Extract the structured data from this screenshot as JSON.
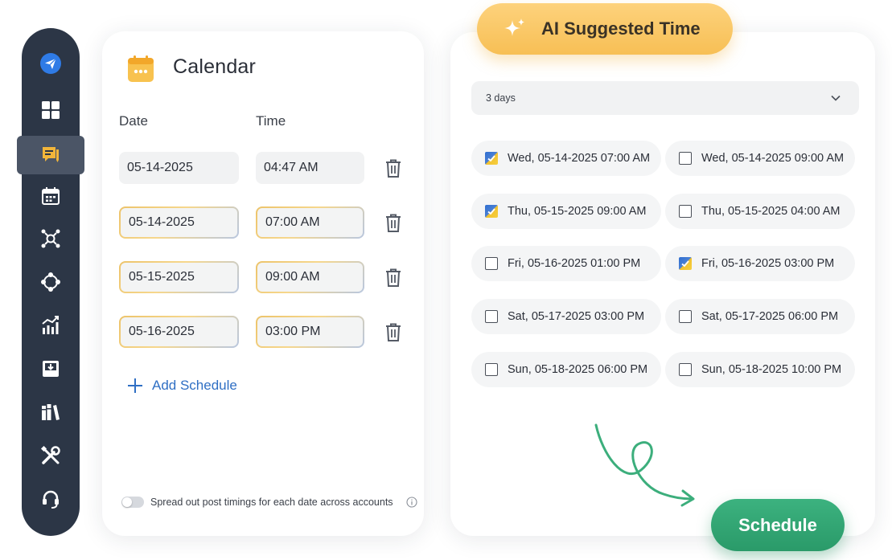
{
  "sidebar": {
    "items": [
      {
        "icon": "send-icon"
      },
      {
        "icon": "dashboard-icon"
      },
      {
        "icon": "compose-icon",
        "active": true
      },
      {
        "icon": "calendar-icon"
      },
      {
        "icon": "network-icon"
      },
      {
        "icon": "hub-icon"
      },
      {
        "icon": "analytics-icon"
      },
      {
        "icon": "inbox-icon"
      },
      {
        "icon": "library-icon"
      },
      {
        "icon": "tools-icon"
      },
      {
        "icon": "support-icon"
      }
    ]
  },
  "calendar": {
    "title": "Calendar",
    "date_label": "Date",
    "time_label": "Time",
    "rows": [
      {
        "date": "05-14-2025",
        "time": "04:47 AM",
        "highlighted": false
      },
      {
        "date": "05-14-2025",
        "time": "07:00 AM",
        "highlighted": true
      },
      {
        "date": "05-15-2025",
        "time": "09:00 AM",
        "highlighted": true
      },
      {
        "date": "05-16-2025",
        "time": "03:00 PM",
        "highlighted": true
      }
    ],
    "add_schedule_label": "Add Schedule",
    "spread_label": "Spread out post timings for each date across accounts"
  },
  "ai": {
    "badge_label": "AI Suggested Time",
    "range_value": "3 days",
    "slots": [
      [
        "Wed, 05-14-2025 07:00 AM",
        "Wed, 05-14-2025 09:00 AM"
      ],
      [
        "Thu, 05-15-2025 09:00 AM",
        "Thu, 05-15-2025 04:00 AM"
      ],
      [
        "Fri, 05-16-2025 01:00 PM",
        "Fri, 05-16-2025 03:00 PM"
      ],
      [
        "Sat, 05-17-2025 03:00 PM",
        "Sat, 05-17-2025 06:00 PM"
      ],
      [
        "Sun, 05-18-2025 06:00 PM",
        "Sun, 05-18-2025 10:00 PM"
      ]
    ],
    "checked": [
      [
        true,
        false
      ],
      [
        true,
        false
      ],
      [
        false,
        true
      ],
      [
        false,
        false
      ],
      [
        false,
        false
      ]
    ],
    "schedule_label": "Schedule"
  },
  "colors": {
    "sidebar_bg": "#2c3646",
    "accent_blue": "#2f6fc4",
    "badge_yellow": "#f7bf55",
    "schedule_green": "#2fa571"
  }
}
